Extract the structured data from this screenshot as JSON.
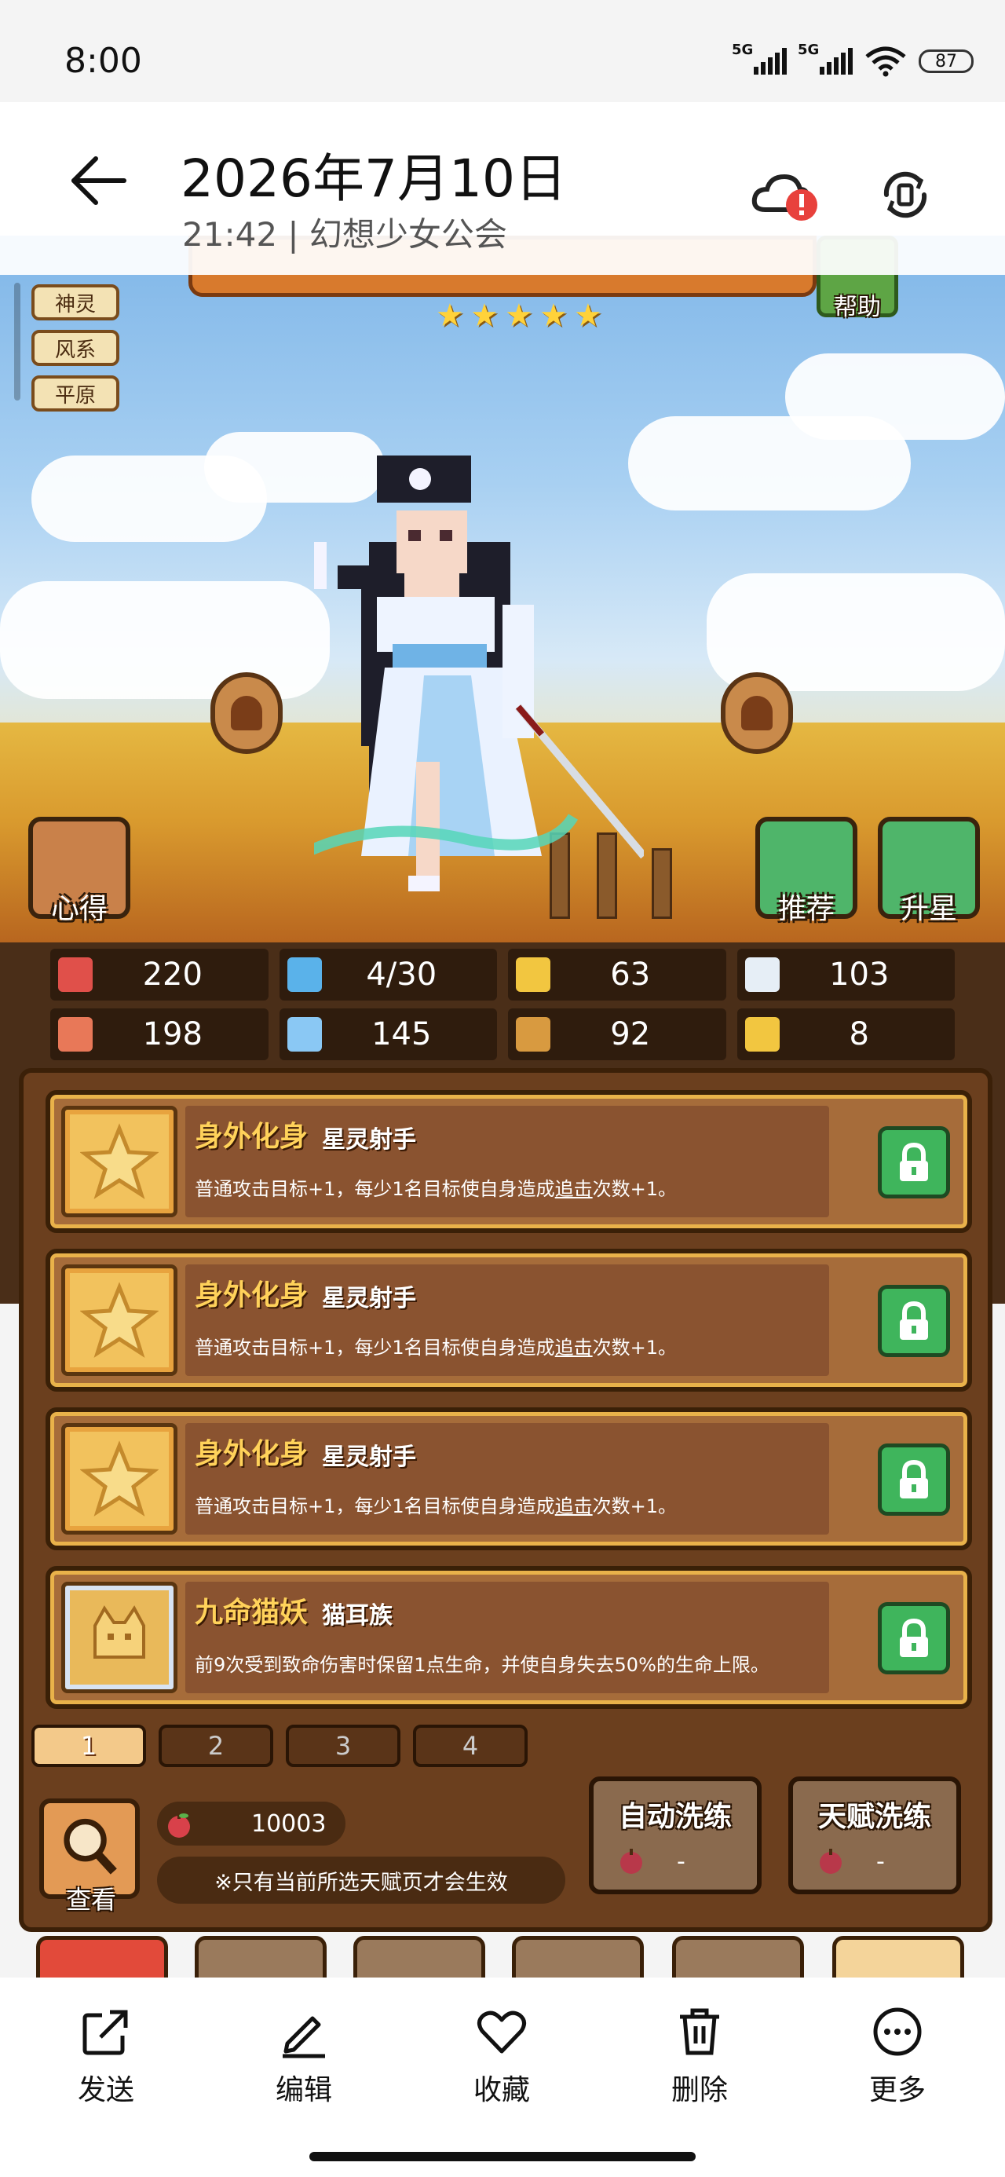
{
  "status_bar": {
    "time": "8:00",
    "signal_1": "5G",
    "signal_2": "5G",
    "battery": "87"
  },
  "header": {
    "title": "2026年7月10日",
    "subtitle": "21:42 | 幻想少女公会",
    "alert_color": "#e8413c"
  },
  "game": {
    "side_tags": [
      "神灵",
      "风系",
      "平原"
    ],
    "help_label": "帮助",
    "star_count": 5,
    "left_action": "心得",
    "right_actions": [
      "推荐",
      "升星"
    ],
    "stats": [
      {
        "icon": "heart-icon",
        "value": "220",
        "color": "#e0504a"
      },
      {
        "icon": "water-drop-icon",
        "value": "4/30",
        "color": "#5ab2ea"
      },
      {
        "icon": "shield-icon",
        "value": "63",
        "color": "#f2c640"
      },
      {
        "icon": "wing-icon",
        "value": "103",
        "color": "#e6eef6"
      },
      {
        "icon": "fist-icon",
        "value": "198",
        "color": "#e87858"
      },
      {
        "icon": "book-icon",
        "value": "145",
        "color": "#8ac8f4"
      },
      {
        "icon": "speed-icon",
        "value": "92",
        "color": "#d89a40"
      },
      {
        "icon": "horseshoe-icon",
        "value": "8",
        "color": "#f2c640"
      }
    ],
    "talents": [
      {
        "name": "身外化身",
        "race": "星灵射手",
        "desc_before": "普通攻击目标+1，每少1名目标使自身造成",
        "desc_link": "追击",
        "desc_after": "次数+1。",
        "icon": "star-icon"
      },
      {
        "name": "身外化身",
        "race": "星灵射手",
        "desc_before": "普通攻击目标+1，每少1名目标使自身造成",
        "desc_link": "追击",
        "desc_after": "次数+1。",
        "icon": "star-icon"
      },
      {
        "name": "身外化身",
        "race": "星灵射手",
        "desc_before": "普通攻击目标+1，每少1名目标使自身造成",
        "desc_link": "追击",
        "desc_after": "次数+1。",
        "icon": "star-icon"
      },
      {
        "name": "九命猫妖",
        "race": "猫耳族",
        "desc_before": "前9次受到致命伤害时保留1点生命，并使自身失去50%的生命上限。",
        "desc_link": "",
        "desc_after": "",
        "icon": "cat-icon"
      }
    ],
    "pages": [
      "1",
      "2",
      "3",
      "4"
    ],
    "active_page": "1",
    "view_label": "查看",
    "resource_value": "10003",
    "note": "※只有当前所选天赋页才会生效",
    "auto_wash": {
      "title": "自动洗练",
      "cost": "-"
    },
    "talent_wash": {
      "title": "天赋洗练",
      "cost": "-"
    }
  },
  "action_bar": {
    "send": "发送",
    "edit": "编辑",
    "favorite": "收藏",
    "delete": "删除",
    "more": "更多"
  }
}
